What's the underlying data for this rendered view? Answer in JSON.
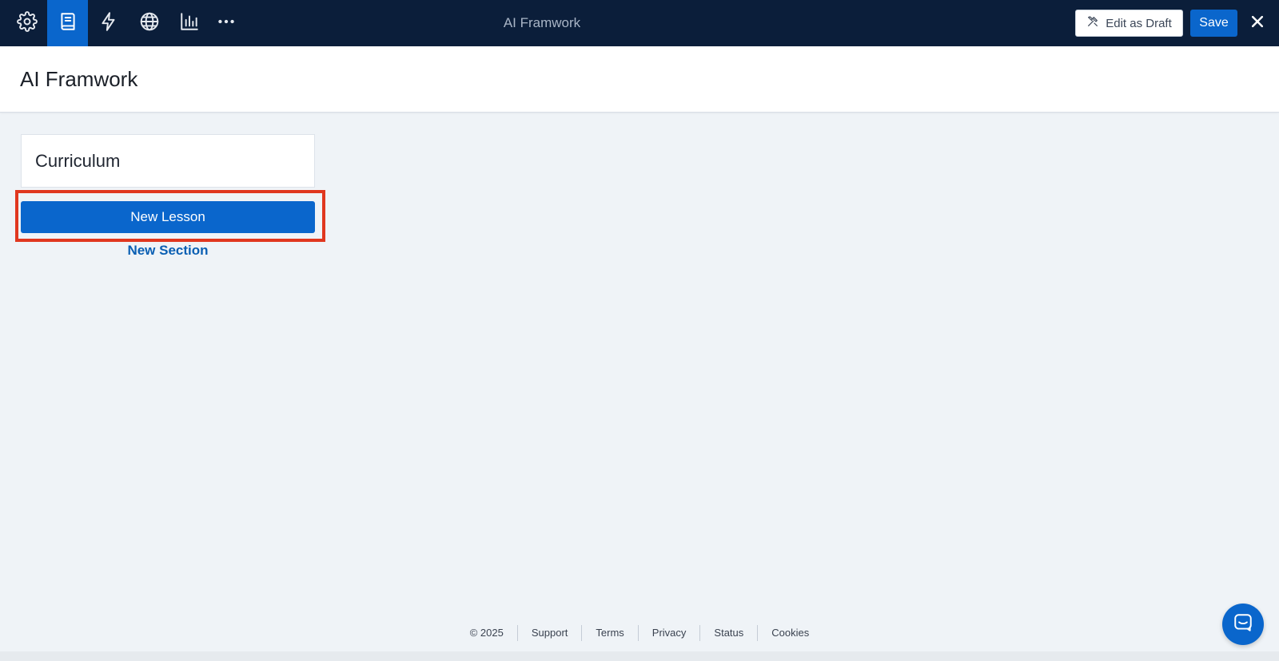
{
  "topbar": {
    "title": "AI Framwork",
    "tools": [
      {
        "icon": "gear-icon"
      },
      {
        "icon": "book-icon",
        "active": true
      },
      {
        "icon": "lightning-icon"
      },
      {
        "icon": "globe-icon"
      },
      {
        "icon": "bar-chart-icon"
      },
      {
        "icon": "more-icon"
      }
    ],
    "edit_draft_label": "Edit as Draft",
    "save_label": "Save"
  },
  "header": {
    "title": "AI Framwork"
  },
  "curriculum": {
    "card_label": "Curriculum",
    "new_lesson_label": "New Lesson",
    "new_section_label": "New Section"
  },
  "footer": {
    "items": [
      "© 2025",
      "Support",
      "Terms",
      "Privacy",
      "Status",
      "Cookies"
    ]
  },
  "colors": {
    "topbar_bg": "#0b1e3a",
    "accent": "#0a66cc",
    "highlight": "#e0371f",
    "page_bg": "#eff3f7"
  }
}
